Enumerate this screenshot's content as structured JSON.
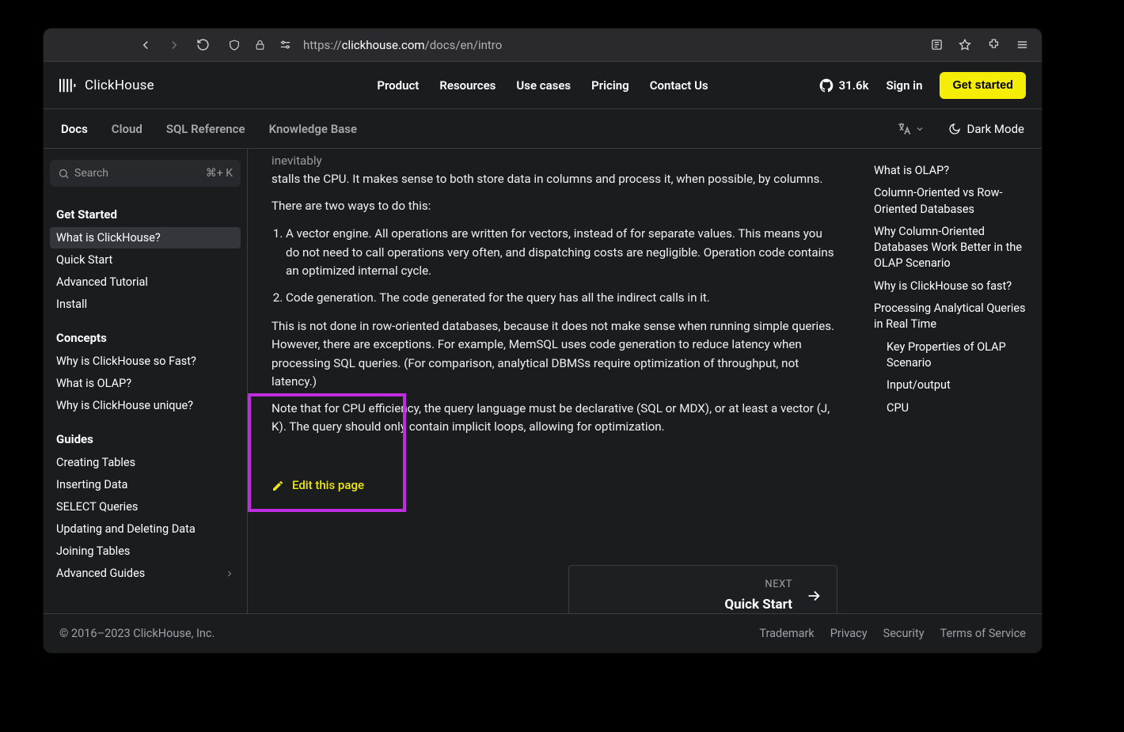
{
  "browser": {
    "url_prefix": "https://",
    "url_host": "clickhouse.com",
    "url_path": "/docs/en/intro"
  },
  "header": {
    "logo_text": "ClickHouse",
    "nav": [
      "Product",
      "Resources",
      "Use cases",
      "Pricing",
      "Contact Us"
    ],
    "github_stars": "31.6k",
    "signin": "Sign in",
    "get_started": "Get started"
  },
  "secnav": {
    "items": [
      {
        "label": "Docs",
        "active": true
      },
      {
        "label": "Cloud",
        "active": false
      },
      {
        "label": "SQL Reference",
        "active": false
      },
      {
        "label": "Knowledge Base",
        "active": false
      }
    ],
    "dark_mode": "Dark Mode"
  },
  "sidebar": {
    "search_placeholder": "Search",
    "search_kbd": "⌘+  K",
    "sections": [
      {
        "title": "Get Started",
        "items": [
          {
            "label": "What is ClickHouse?",
            "active": true
          },
          {
            "label": "Quick Start"
          },
          {
            "label": "Advanced Tutorial"
          },
          {
            "label": "Install"
          }
        ]
      },
      {
        "title": "Concepts",
        "items": [
          {
            "label": "Why is ClickHouse so Fast?"
          },
          {
            "label": "What is OLAP?"
          },
          {
            "label": "Why is ClickHouse unique?"
          }
        ]
      },
      {
        "title": "Guides",
        "items": [
          {
            "label": "Creating Tables"
          },
          {
            "label": "Inserting Data"
          },
          {
            "label": "SELECT Queries"
          },
          {
            "label": "Updating and Deleting Data"
          },
          {
            "label": "Joining Tables"
          },
          {
            "label": "Advanced Guides",
            "chevron": true
          }
        ]
      }
    ]
  },
  "content": {
    "p0_tail": "stalls the CPU. It makes sense to both store data in columns and process it, when possible, by columns.",
    "p1": "There are two ways to do this:",
    "li1": "A vector engine. All operations are written for vectors, instead of for separate values. This means you do not need to call operations very often, and dispatching costs are negligible. Operation code contains an optimized internal cycle.",
    "li2": "Code generation. The code generated for the query has all the indirect calls in it.",
    "p2": "This is not done in row-oriented databases, because it does not make sense when running simple queries. However, there are exceptions. For example, MemSQL uses code generation to reduce latency when processing SQL queries. (For comparison, analytical DBMSs require optimization of throughput, not latency.)",
    "p3": "Note that for CPU efficiency, the query language must be declarative (SQL or MDX), or at least a vector (J, K). The query should only contain implicit loops, allowing for optimization.",
    "edit_label": "Edit this page",
    "next_eyebrow": "NEXT",
    "next_title": "Quick Start"
  },
  "toc": [
    {
      "label": "What is OLAP?"
    },
    {
      "label": "Column-Oriented vs Row-Oriented Databases"
    },
    {
      "label": "Why Column-Oriented Databases Work Better in the OLAP Scenario"
    },
    {
      "label": "Why is ClickHouse so fast?"
    },
    {
      "label": "Processing Analytical Queries in Real Time"
    },
    {
      "label": "Key Properties of OLAP Scenario",
      "sub": true
    },
    {
      "label": "Input/output",
      "sub": true
    },
    {
      "label": "CPU",
      "sub": true
    }
  ],
  "footer": {
    "copyright": "© 2016–2023 ClickHouse, Inc.",
    "links": [
      "Trademark",
      "Privacy",
      "Security",
      "Terms of Service"
    ]
  }
}
